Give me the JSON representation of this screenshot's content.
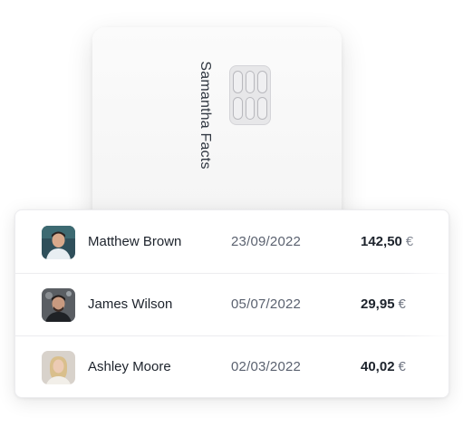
{
  "card": {
    "holder_name": "Samantha Facts"
  },
  "transactions": [
    {
      "name": "Matthew Brown",
      "date": "23/09/2022",
      "amount": "142,50",
      "currency": "€",
      "avatar": "avatar-matthew-brown"
    },
    {
      "name": "James Wilson",
      "date": "05/07/2022",
      "amount": "29,95",
      "currency": "€",
      "avatar": "avatar-james-wilson"
    },
    {
      "name": "Ashley Moore",
      "date": "02/03/2022",
      "amount": "40,02",
      "currency": "€",
      "avatar": "avatar-ashley-moore"
    }
  ]
}
